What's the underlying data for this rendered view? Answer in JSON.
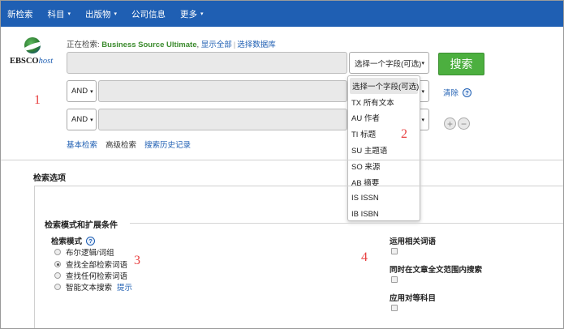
{
  "topnav": {
    "items": [
      {
        "label": "新检索",
        "has_caret": false
      },
      {
        "label": "科目",
        "has_caret": true
      },
      {
        "label": "出版物",
        "has_caret": true
      },
      {
        "label": "公司信息",
        "has_caret": false
      },
      {
        "label": "更多",
        "has_caret": true
      }
    ],
    "caret": "▾",
    "bg_color": "#1f5fb3"
  },
  "logo": {
    "brand": "EBSCO",
    "suffix": "host"
  },
  "searching": {
    "prefix": "正在检索: ",
    "database": "Business Source Ultimate",
    "comma": ",",
    "show_all": "显示全部",
    "sep": "|",
    "choose_db": "选择数据库"
  },
  "search_rows": [
    {
      "bool": "",
      "field": "选择一个字段(可选)"
    },
    {
      "bool": "AND",
      "field": ""
    },
    {
      "bool": "AND",
      "field": ""
    }
  ],
  "search_button": "搜索",
  "clear_link": "清除",
  "help_glyph": "?",
  "plus_glyph": "+",
  "minus_glyph": "−",
  "bottom_links": {
    "basic": "基本检索",
    "advanced": "高级检索",
    "history": "搜索历史记录"
  },
  "field_dropdown": {
    "options": [
      "选择一个字段(可选)",
      "TX 所有文本",
      "AU 作者",
      "TI 标题",
      "SU 主题语",
      "SO 来源",
      "AB 摘要",
      "IS ISSN",
      "IB ISBN"
    ]
  },
  "annotations": [
    "1",
    "2",
    "3",
    "4"
  ],
  "options": {
    "title": "检索选项",
    "section_title": "检索模式和扩展条件",
    "mode_label": "检索模式",
    "modes": [
      {
        "label": "布尔逻辑/词组",
        "checked": false
      },
      {
        "label": "查找全部检索词语",
        "checked": true
      },
      {
        "label": "查找任何检索词语",
        "checked": false
      },
      {
        "label": "智能文本搜索",
        "checked": false,
        "hint": "提示"
      }
    ],
    "expanders": [
      {
        "label": "运用相关词语",
        "checked": false
      },
      {
        "label": "同时在文章全文范围内搜索",
        "checked": false
      },
      {
        "label": "应用对等科目",
        "checked": false
      }
    ]
  },
  "colors": {
    "accent": "#1f5fb3",
    "search_green": "#4caf3f",
    "db_green": "#3b8b2d",
    "annotation_red": "#e84040"
  }
}
